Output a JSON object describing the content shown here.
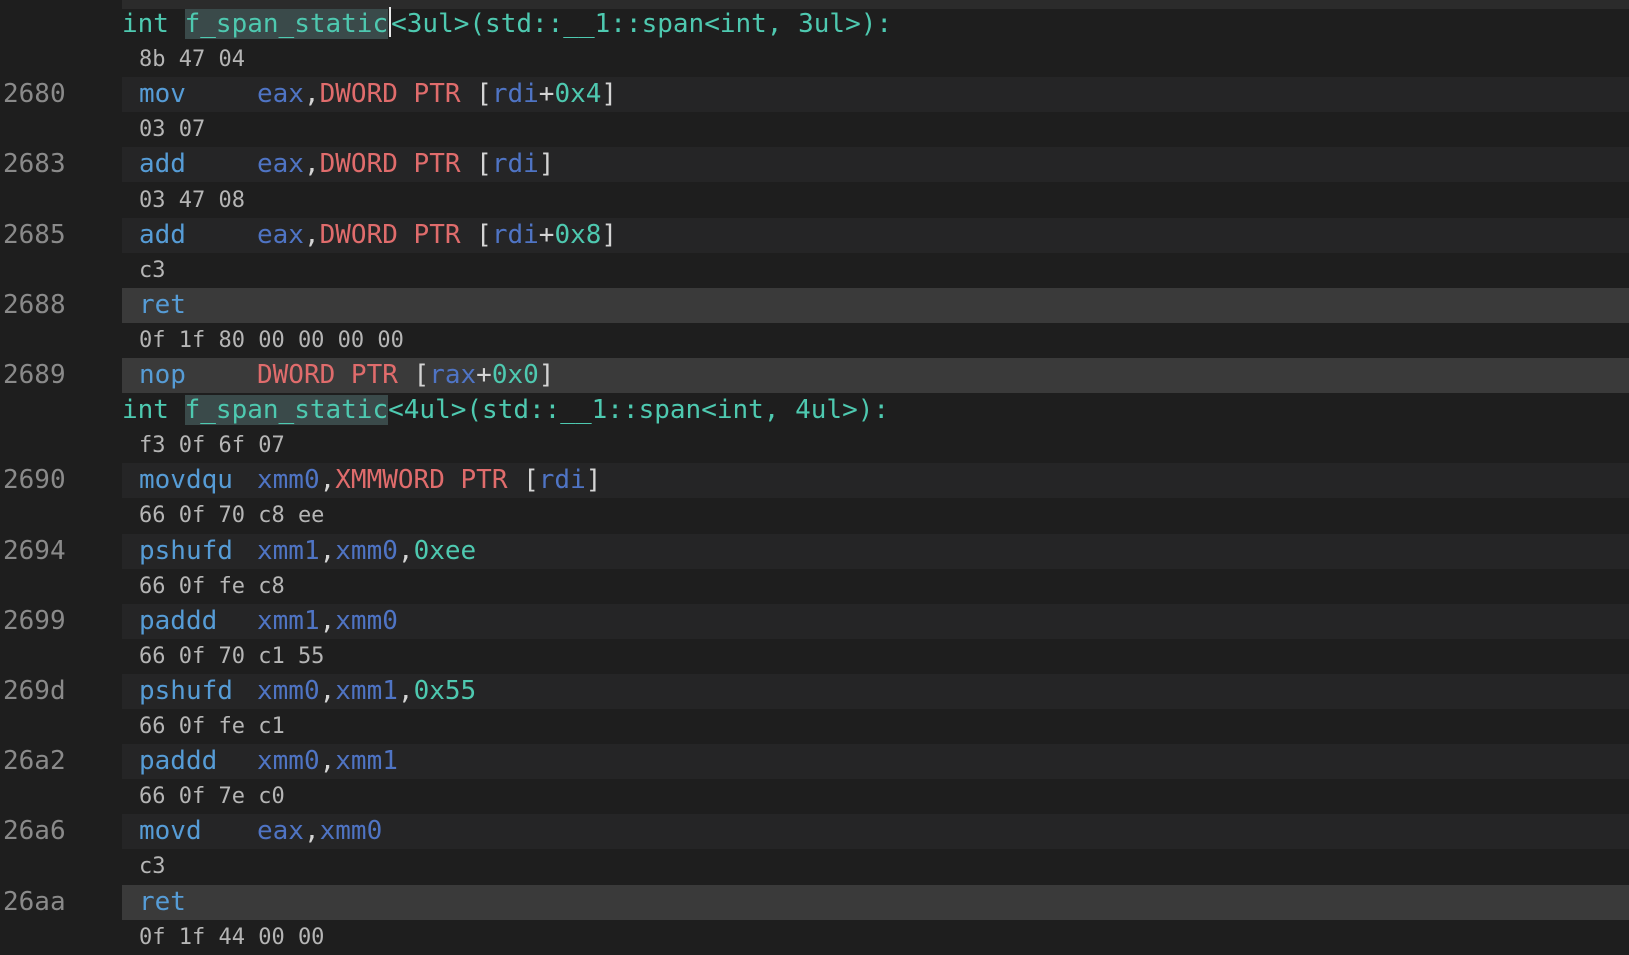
{
  "functions": [
    {
      "signature_prefix": "int ",
      "name": "f_span_static",
      "signature_suffix": "<3ul>(std::__1::span<int, 3ul>):"
    },
    {
      "signature_prefix": "int ",
      "name": "f_span_static",
      "signature_suffix": "<4ul>(std::__1::span<int, 4ul>):"
    }
  ],
  "instructions": [
    {
      "bytes": "8b 47 04",
      "addr": "2680",
      "mnemonic": "mov",
      "ops": [
        [
          "rg",
          "eax"
        ],
        [
          "pn",
          ","
        ],
        [
          "kw",
          "DWORD PTR"
        ],
        [
          "pn",
          " ["
        ],
        [
          "rg",
          "rdi"
        ],
        [
          "pn",
          "+"
        ],
        [
          "nm",
          "0x4"
        ],
        [
          "pn",
          "]"
        ]
      ]
    },
    {
      "bytes": "03 07",
      "addr": "2683",
      "mnemonic": "add",
      "ops": [
        [
          "rg",
          "eax"
        ],
        [
          "pn",
          ","
        ],
        [
          "kw",
          "DWORD PTR"
        ],
        [
          "pn",
          " ["
        ],
        [
          "rg",
          "rdi"
        ],
        [
          "pn",
          "]"
        ]
      ]
    },
    {
      "bytes": "03 47 08",
      "addr": "2685",
      "mnemonic": "add",
      "ops": [
        [
          "rg",
          "eax"
        ],
        [
          "pn",
          ","
        ],
        [
          "kw",
          "DWORD PTR"
        ],
        [
          "pn",
          " ["
        ],
        [
          "rg",
          "rdi"
        ],
        [
          "pn",
          "+"
        ],
        [
          "nm",
          "0x8"
        ],
        [
          "pn",
          "]"
        ]
      ]
    },
    {
      "bytes": "c3",
      "addr": "2688",
      "mnemonic": "ret",
      "ops": [],
      "current": true
    },
    {
      "bytes": "0f 1f 80 00 00 00 00",
      "addr": "2689",
      "mnemonic": "nop",
      "ops": [
        [
          "kw",
          "DWORD PTR"
        ],
        [
          "pn",
          " ["
        ],
        [
          "rg",
          "rax"
        ],
        [
          "pn",
          "+"
        ],
        [
          "nm",
          "0x0"
        ],
        [
          "pn",
          "]"
        ]
      ],
      "current": true
    },
    {
      "bytes": "f3 0f 6f 07",
      "addr": "2690",
      "mnemonic": "movdqu",
      "ops": [
        [
          "rg",
          "xmm0"
        ],
        [
          "pn",
          ","
        ],
        [
          "kw",
          "XMMWORD PTR"
        ],
        [
          "pn",
          " ["
        ],
        [
          "rg",
          "rdi"
        ],
        [
          "pn",
          "]"
        ]
      ]
    },
    {
      "bytes": "66 0f 70 c8 ee",
      "addr": "2694",
      "mnemonic": "pshufd",
      "ops": [
        [
          "rg",
          "xmm1"
        ],
        [
          "pn",
          ","
        ],
        [
          "rg",
          "xmm0"
        ],
        [
          "pn",
          ","
        ],
        [
          "nm",
          "0xee"
        ]
      ]
    },
    {
      "bytes": "66 0f fe c8",
      "addr": "2699",
      "mnemonic": "paddd",
      "ops": [
        [
          "rg",
          "xmm1"
        ],
        [
          "pn",
          ","
        ],
        [
          "rg",
          "xmm0"
        ]
      ]
    },
    {
      "bytes": "66 0f 70 c1 55",
      "addr": "269d",
      "mnemonic": "pshufd",
      "ops": [
        [
          "rg",
          "xmm0"
        ],
        [
          "pn",
          ","
        ],
        [
          "rg",
          "xmm1"
        ],
        [
          "pn",
          ","
        ],
        [
          "nm",
          "0x55"
        ]
      ]
    },
    {
      "bytes": "66 0f fe c1",
      "addr": "26a2",
      "mnemonic": "paddd",
      "ops": [
        [
          "rg",
          "xmm0"
        ],
        [
          "pn",
          ","
        ],
        [
          "rg",
          "xmm1"
        ]
      ]
    },
    {
      "bytes": "66 0f 7e c0",
      "addr": "26a6",
      "mnemonic": "movd",
      "ops": [
        [
          "rg",
          "eax"
        ],
        [
          "pn",
          ","
        ],
        [
          "rg",
          "xmm0"
        ]
      ]
    },
    {
      "bytes": "c3",
      "addr": "26aa",
      "mnemonic": "ret",
      "ops": [],
      "current": true
    }
  ],
  "trailing_bytes": "0f 1f 44 00 00",
  "colors": {
    "background": "#1e1e1e",
    "function_label": "#4ec9b0",
    "mnemonic": "#569cd6",
    "register": "#4f74c4",
    "keyword": "#e06c6c",
    "number": "#4ec9b0",
    "line_number": "#8a8a8a"
  }
}
